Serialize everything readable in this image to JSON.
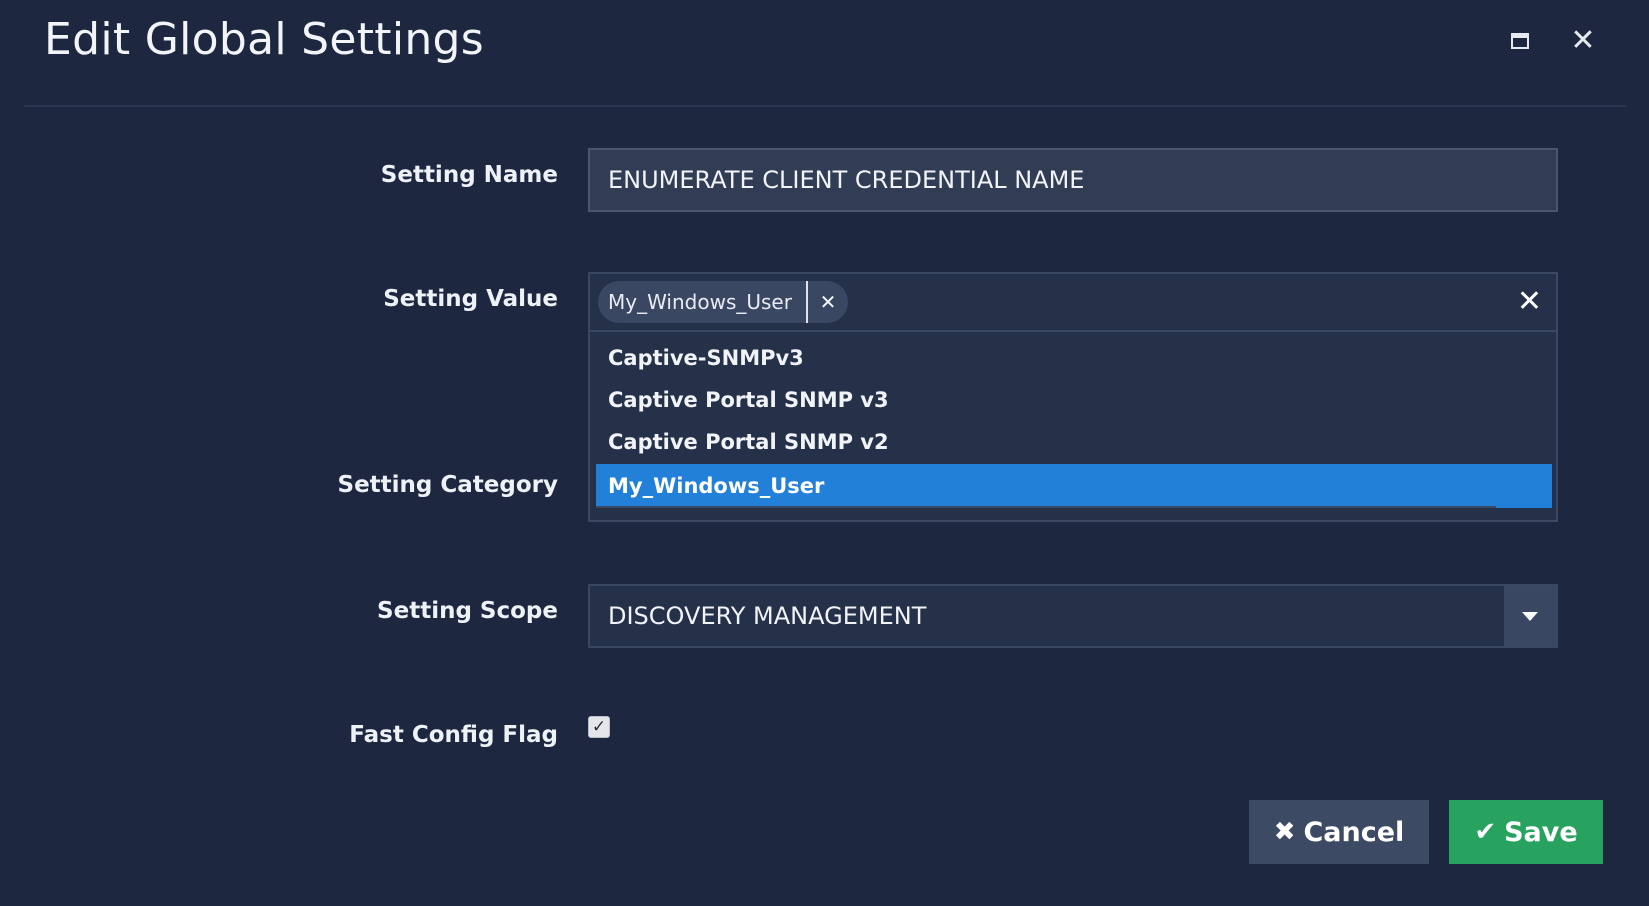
{
  "dialog": {
    "title": "Edit Global Settings"
  },
  "window_controls": {
    "maximize_icon": "maximize-icon",
    "close_glyph": "✕"
  },
  "form": {
    "setting_name": {
      "label": "Setting Name",
      "value": "ENUMERATE CLIENT CREDENTIAL NAME"
    },
    "setting_value": {
      "label": "Setting Value",
      "chips": [
        "My_Windows_User"
      ],
      "chip_remove_glyph": "✕",
      "clear_glyph": "✕",
      "options": [
        {
          "label": "Captive-SNMPv3",
          "selected": false
        },
        {
          "label": "Captive Portal SNMP v3",
          "selected": false
        },
        {
          "label": "Captive Portal SNMP v2",
          "selected": false
        },
        {
          "label": "My_Windows_User",
          "selected": true
        }
      ]
    },
    "setting_category": {
      "label": "Setting Category"
    },
    "setting_scope": {
      "label": "Setting Scope",
      "value": "DISCOVERY MANAGEMENT"
    },
    "fast_config_flag": {
      "label": "Fast Config Flag",
      "checked": true,
      "check_glyph": "✓"
    }
  },
  "actions": {
    "cancel_label": "Cancel",
    "cancel_glyph": "✖",
    "save_label": "Save",
    "save_glyph": "✔"
  },
  "colors": {
    "background": "#1d2840",
    "selected_option": "#2280d8",
    "save_button": "#27a35f",
    "cancel_button": "#3d4a63"
  }
}
